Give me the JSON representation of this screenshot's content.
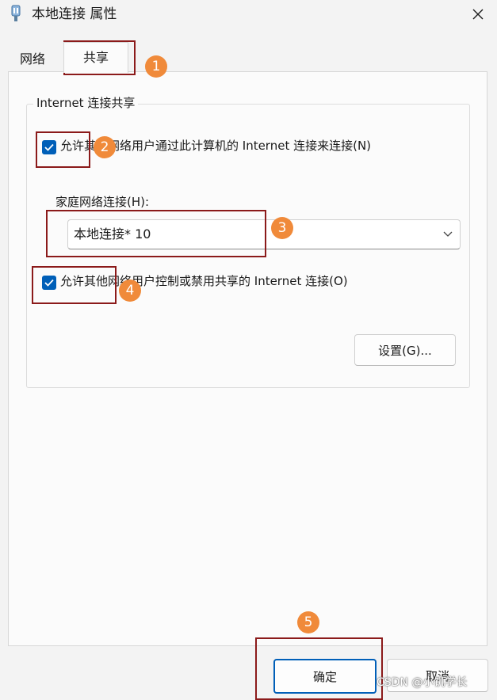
{
  "window": {
    "title": "本地连接 属性"
  },
  "tabs": [
    {
      "label": "网络"
    },
    {
      "label": "共享"
    }
  ],
  "sharing": {
    "group_title": "Internet 连接共享",
    "allow_connect": {
      "label": "允许其他网络用户通过此计算机的 Internet 连接来连接(N)",
      "checked": true
    },
    "home_network_label": "家庭网络连接(H):",
    "home_network_value": "本地连接* 10",
    "allow_control": {
      "label": "允许其他网络用户控制或禁用共享的 Internet 连接(O)",
      "checked": true
    },
    "settings_button": "设置(G)..."
  },
  "footer": {
    "ok_button": "确定",
    "cancel_button": "取消"
  },
  "annotations": [
    "1",
    "2",
    "3",
    "4",
    "5"
  ],
  "watermark": "CSDN @小饥学长",
  "colors": {
    "accent": "#005fb8",
    "badge": "#f08a3a",
    "annotation_border": "#8b1a1a"
  }
}
